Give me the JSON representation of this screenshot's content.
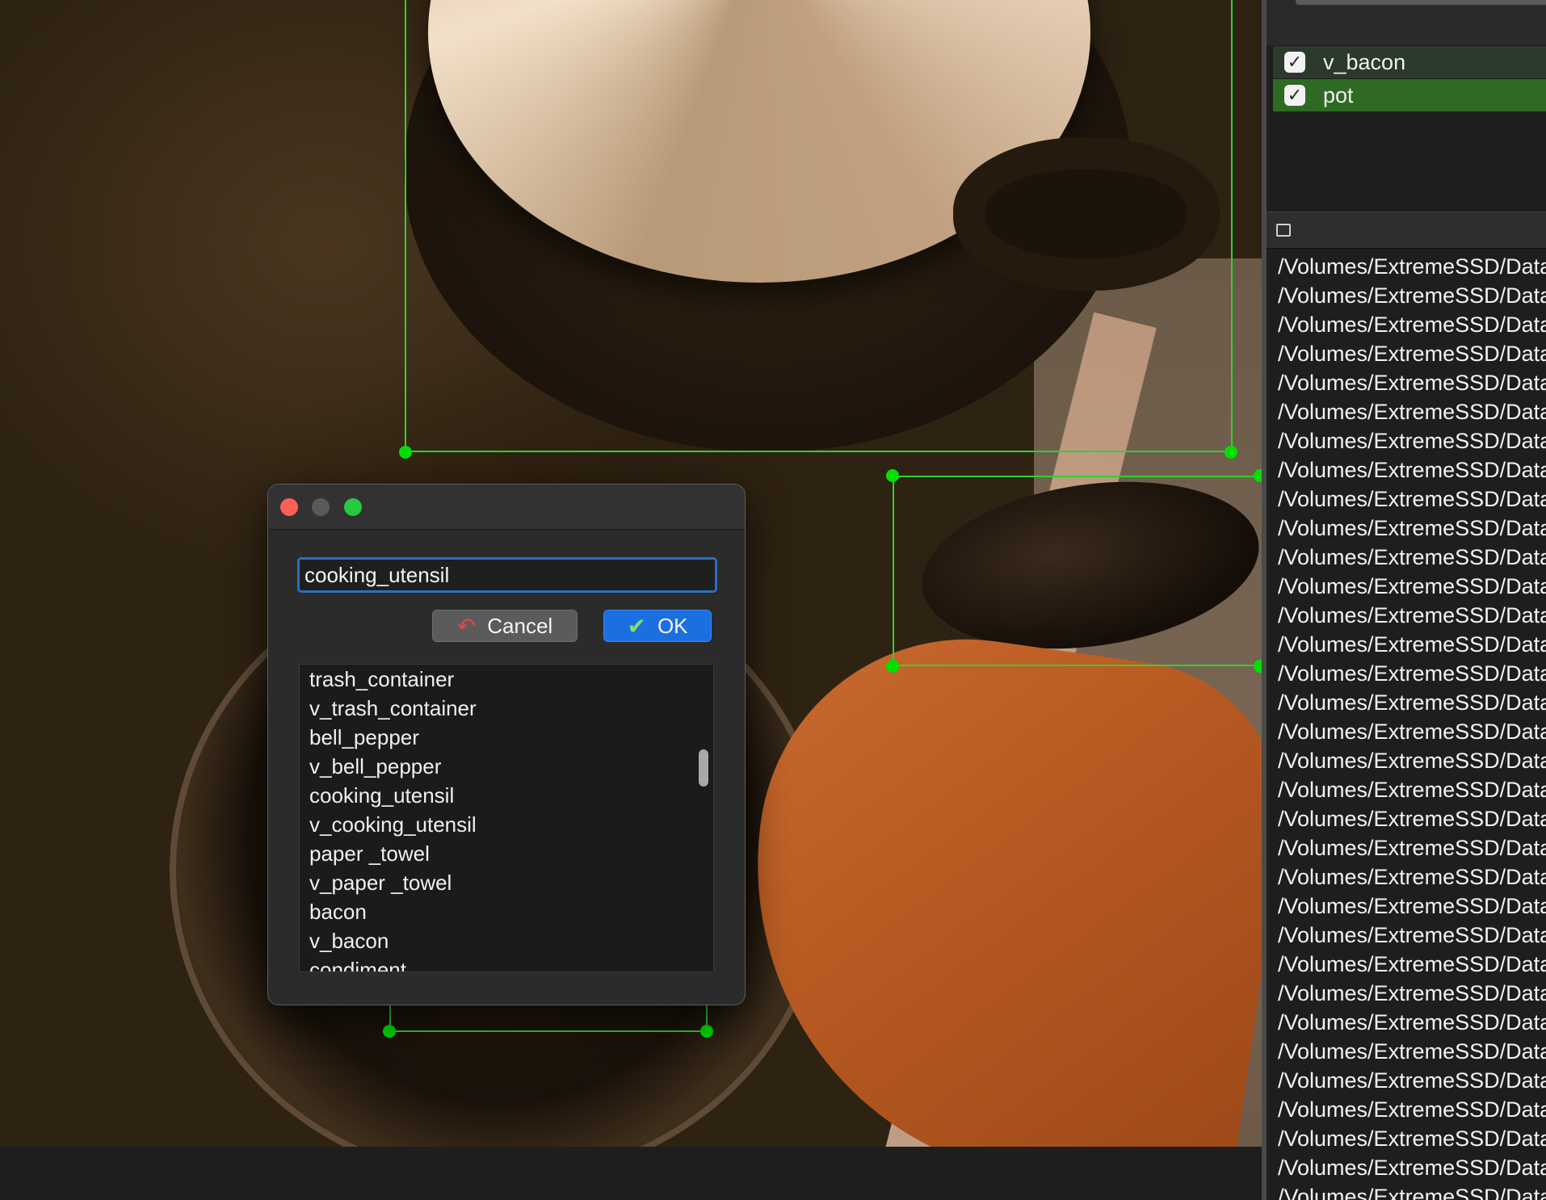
{
  "dialog": {
    "input_value": "cooking_utensil",
    "cancel_label": "Cancel",
    "ok_label": "OK",
    "label_options": [
      "trash_container",
      "v_trash_container",
      "bell_pepper",
      "v_bell_pepper",
      "cooking_utensil",
      "v_cooking_utensil",
      "paper _towel",
      "v_paper _towel",
      "bacon",
      "v_bacon",
      "condiment"
    ],
    "list_scroll_position": 0.25
  },
  "label_list": {
    "items": [
      {
        "label": "v_bacon",
        "checked": true
      },
      {
        "label": "pot",
        "checked": true,
        "selected": true
      }
    ]
  },
  "file_list": {
    "rows": [
      "/Volumes/ExtremeSSD/Data",
      "/Volumes/ExtremeSSD/Data",
      "/Volumes/ExtremeSSD/Data",
      "/Volumes/ExtremeSSD/Data",
      "/Volumes/ExtremeSSD/Data",
      "/Volumes/ExtremeSSD/Data",
      "/Volumes/ExtremeSSD/Data",
      "/Volumes/ExtremeSSD/Data",
      "/Volumes/ExtremeSSD/Data",
      "/Volumes/ExtremeSSD/Data",
      "/Volumes/ExtremeSSD/Data",
      "/Volumes/ExtremeSSD/Data",
      "/Volumes/ExtremeSSD/Data",
      "/Volumes/ExtremeSSD/Data",
      "/Volumes/ExtremeSSD/Data",
      "/Volumes/ExtremeSSD/Data",
      "/Volumes/ExtremeSSD/Data",
      "/Volumes/ExtremeSSD/Data",
      "/Volumes/ExtremeSSD/Data",
      "/Volumes/ExtremeSSD/Data",
      "/Volumes/ExtremeSSD/Data",
      "/Volumes/ExtremeSSD/Data",
      "/Volumes/ExtremeSSD/Data",
      "/Volumes/ExtremeSSD/Data",
      "/Volumes/ExtremeSSD/Data",
      "/Volumes/ExtremeSSD/Data",
      "/Volumes/ExtremeSSD/Data",
      "/Volumes/ExtremeSSD/Data",
      "/Volumes/ExtremeSSD/Data",
      "/Volumes/ExtremeSSD/Data",
      "/Volumes/ExtremeSSD/Data",
      "/Volumes/ExtremeSSD/Data",
      "/Volumes/ExtremeSSD/Data"
    ]
  },
  "icons": {
    "cancel": "undo-arrow-icon",
    "ok": "checkmark-icon",
    "undock": "undock-icon"
  },
  "colors": {
    "bbox": "#2fd22f",
    "bbox_handle": "#00e000",
    "selected_row": "#2e6a24",
    "ok_button": "#1c6fe0",
    "status_band": "#76902c"
  }
}
